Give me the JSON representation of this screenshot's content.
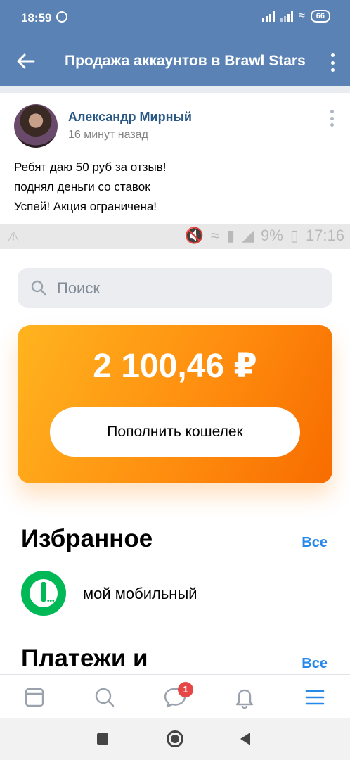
{
  "status_bar": {
    "time": "18:59",
    "battery": "66"
  },
  "app_bar": {
    "title": "Продажа аккаунтов в Brawl Stars"
  },
  "post": {
    "author": "Александр Мирный",
    "time_ago": "16 минут назад",
    "text_lines": [
      "Ребят  даю 50 руб за отзыв!",
      "поднял деньги со ставок",
      "Успей! Акция ограничена!"
    ]
  },
  "embedded_screenshot": {
    "status_bar": {
      "battery_percent": "9%",
      "time": "17:16"
    },
    "search": {
      "placeholder": "Поиск"
    },
    "wallet": {
      "balance": "2 100,46 ₽",
      "topup_label": "Пополнить кошелек",
      "accent_color": "#ff8e0f"
    },
    "favorites": {
      "title": "Избранное",
      "all_label": "Все",
      "items": [
        {
          "label": "мой мобильный",
          "icon": "megafon-logo"
        }
      ]
    },
    "payments": {
      "title": "Платежи и",
      "all_label": "Все"
    }
  },
  "tab_bar": {
    "tabs": [
      {
        "icon": "newsfeed-icon"
      },
      {
        "icon": "search-icon"
      },
      {
        "icon": "messages-icon",
        "badge": "1"
      },
      {
        "icon": "notifications-icon"
      },
      {
        "icon": "menu-icon"
      }
    ],
    "active_color": "#2688eb",
    "badge_color": "#e64646"
  },
  "system_nav": {
    "buttons": [
      "recents",
      "home",
      "back"
    ]
  },
  "colors": {
    "header": "#5b82b4",
    "link": "#2a5885"
  }
}
